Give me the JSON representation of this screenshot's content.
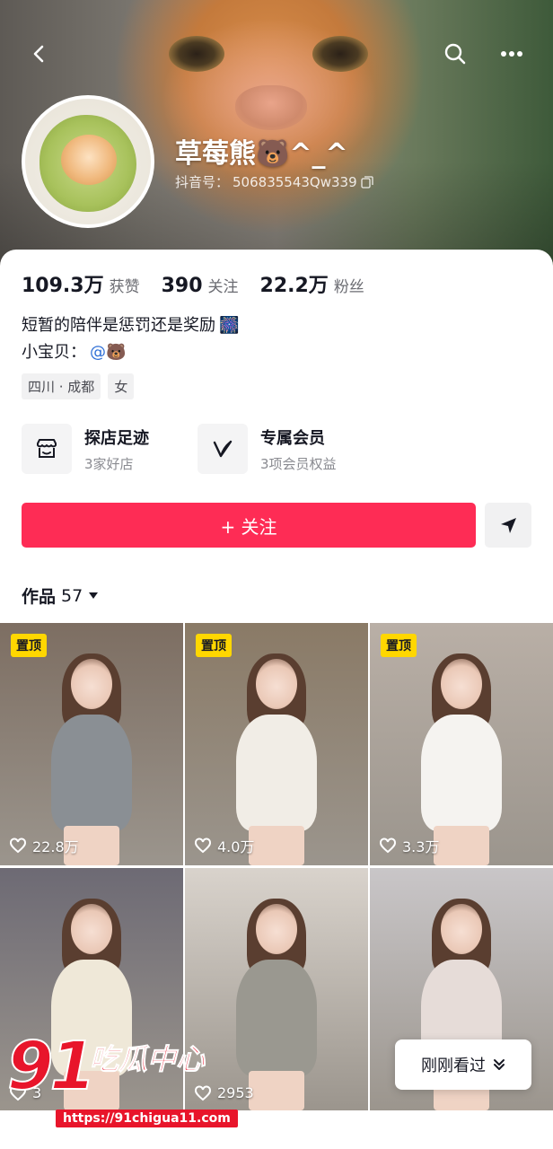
{
  "header": {
    "nickname": "草莓熊🐻^_^",
    "id_label": "抖音号：",
    "id_value": "506835543Qw339"
  },
  "stats": [
    {
      "num": "109.3万",
      "label": "获赞"
    },
    {
      "num": "390",
      "label": "关注"
    },
    {
      "num": "22.2万",
      "label": "粉丝"
    }
  ],
  "bio": {
    "line1": "短暂的陪伴是惩罚还是奖励",
    "line1_emoji": "🎆",
    "line2_label": "小宝贝：",
    "line2_mention": "@🐻"
  },
  "tags": [
    "四川 · 成都",
    "女"
  ],
  "features": [
    {
      "title": "探店足迹",
      "sub": "3家好店",
      "icon": "shop-icon"
    },
    {
      "title": "专属会员",
      "sub": "3项会员权益",
      "icon": "v-member-icon"
    }
  ],
  "actions": {
    "follow_label": "+ 关注",
    "share_icon": "send-icon"
  },
  "works": {
    "label": "作品",
    "count": "57"
  },
  "videos": [
    {
      "pinned": true,
      "pin_label": "置顶",
      "likes": "22.8万",
      "outfit": "#8a8f94",
      "bg": "#7d6e62"
    },
    {
      "pinned": true,
      "pin_label": "置顶",
      "likes": "4.0万",
      "outfit": "#f1ede6",
      "bg": "#8a7a66"
    },
    {
      "pinned": true,
      "pin_label": "置顶",
      "likes": "3.3万",
      "outfit": "#f5f3f0",
      "bg": "#b9afa6"
    },
    {
      "pinned": false,
      "pin_label": "",
      "likes": "3",
      "outfit": "#efe8d8",
      "bg": "#6d6a74"
    },
    {
      "pinned": false,
      "pin_label": "",
      "likes": "2953",
      "outfit": "#9a9890",
      "bg": "#d9d3cc"
    },
    {
      "pinned": false,
      "pin_label": "",
      "likes": "",
      "outfit": "#e6dcd8",
      "bg": "#c9c6c8"
    }
  ],
  "seen_button": "刚刚看过",
  "watermark": {
    "big": "91",
    "cn": "吃瓜中心",
    "url": "https://91chigua11.com"
  },
  "colors": {
    "accent": "#fe2c55",
    "pin": "#ffd700",
    "mention": "#2f6fd6"
  }
}
